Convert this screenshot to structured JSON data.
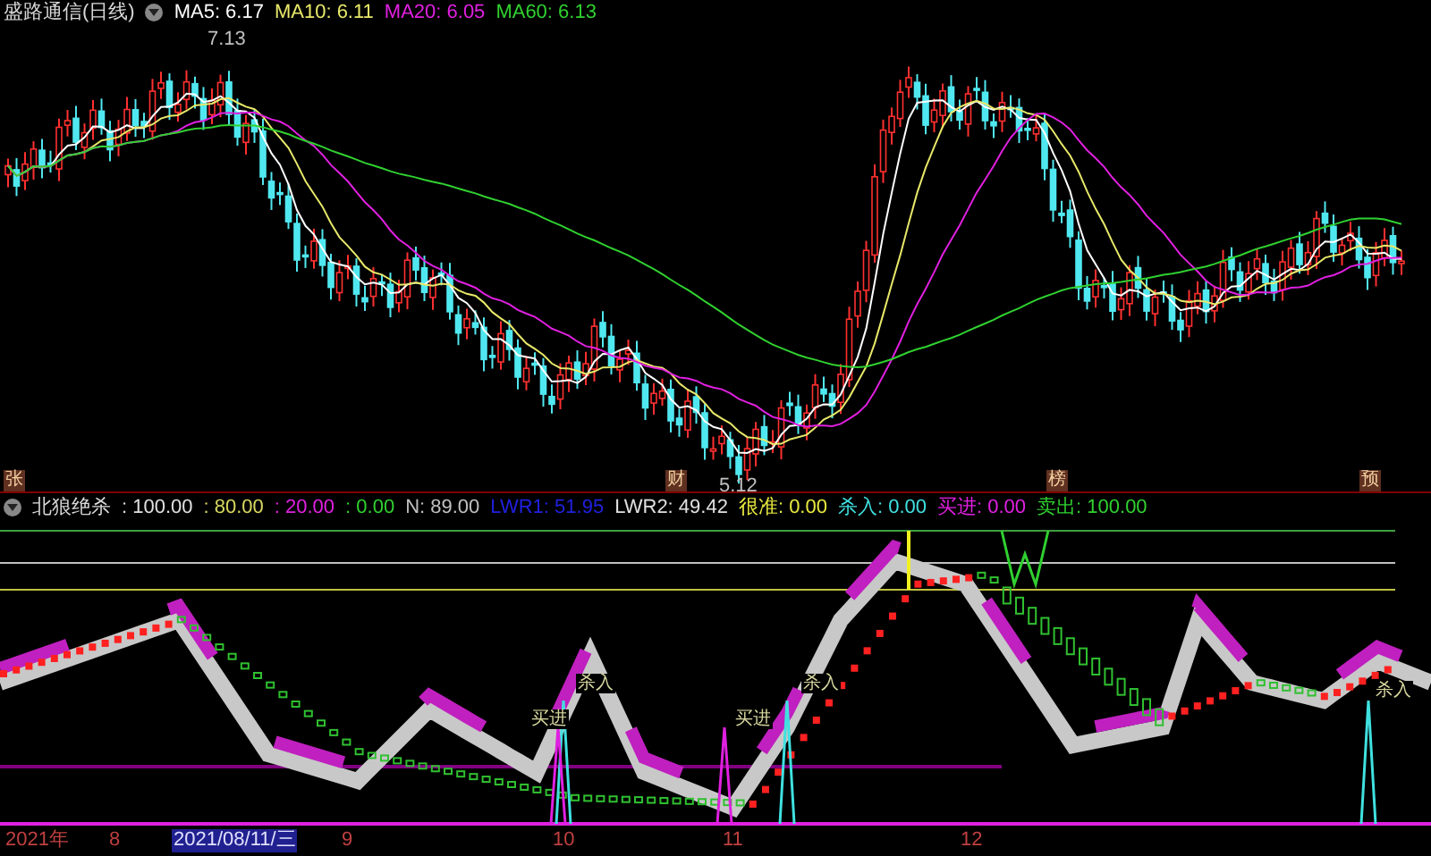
{
  "title": "盛路通信(日线)",
  "moving_averages": [
    {
      "label": "MA5: 6.17",
      "color": "#ffffff"
    },
    {
      "label": "MA10: 6.11",
      "color": "#e8e86a"
    },
    {
      "label": "MA20: 6.05",
      "color": "#e020e0"
    },
    {
      "label": "MA60: 6.13",
      "color": "#30d030"
    }
  ],
  "price_labels": [
    {
      "kind": "high",
      "text": "7.13"
    },
    {
      "kind": "low",
      "text": "5.12"
    }
  ],
  "event_markers": [
    {
      "text": "张"
    },
    {
      "text": "财"
    },
    {
      "text": "榜"
    },
    {
      "text": "预"
    }
  ],
  "indicator": {
    "name": "北狼绝杀",
    "values": [
      {
        "text": ": 100.00",
        "color": "#e0e0e0"
      },
      {
        "text": ": 80.00",
        "color": "#d8d860"
      },
      {
        "text": ": 20.00",
        "color": "#e020e0"
      },
      {
        "text": ": 0.00",
        "color": "#30d030"
      },
      {
        "text": "N: 89.00",
        "color": "#c0c0c0"
      },
      {
        "text": "LWR1: 51.95",
        "color": "#2020e0"
      },
      {
        "text": "LWR2: 49.42",
        "color": "#e0e0e0"
      },
      {
        "text": "很准: 0.00",
        "color": "#e8e840"
      },
      {
        "text": "杀入: 0.00",
        "color": "#40e0e0"
      },
      {
        "text": "买进: 0.00",
        "color": "#e020e0"
      },
      {
        "text": "卖出: 100.00",
        "color": "#30d030"
      }
    ]
  },
  "signals": [
    {
      "text": "杀入"
    },
    {
      "text": "买进"
    },
    {
      "text": "买进"
    },
    {
      "text": "杀入"
    },
    {
      "text": "杀入"
    }
  ],
  "time_axis": [
    {
      "text": "2021年",
      "kind": "label"
    },
    {
      "text": "8",
      "kind": "label"
    },
    {
      "text": "2021/08/11/三",
      "kind": "cursor"
    },
    {
      "text": "9",
      "kind": "label"
    },
    {
      "text": "10",
      "kind": "label"
    },
    {
      "text": "11",
      "kind": "label"
    },
    {
      "text": "12",
      "kind": "label"
    }
  ]
}
